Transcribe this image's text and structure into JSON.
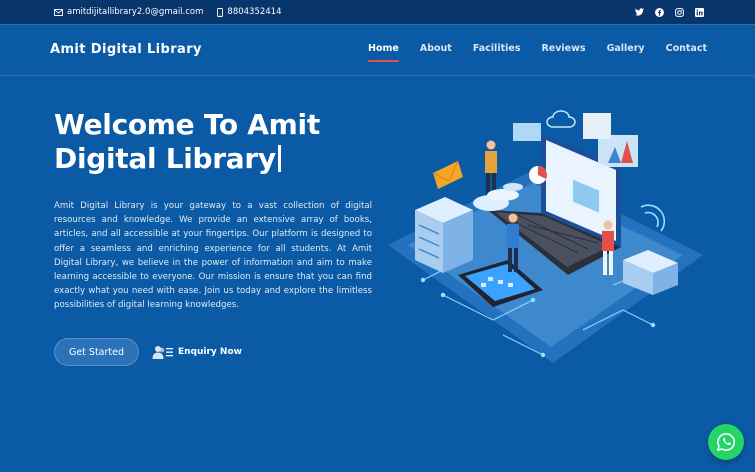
{
  "topbar": {
    "email": "amitdijitallibrary2.0@gmail.com",
    "phone": "8804352414",
    "social": [
      "twitter-icon",
      "facebook-icon",
      "instagram-icon",
      "linkedin-icon"
    ]
  },
  "brand": "Amit Digital Library",
  "nav": {
    "items": [
      "Home",
      "About",
      "Facilities",
      "Reviews",
      "Gallery",
      "Contact"
    ],
    "active": "Home"
  },
  "hero": {
    "title_line1": "Welcome To Amit",
    "title_line2": "Digital Library",
    "description": "Amit Digital Library is your gateway to a vast collection of digital resources and knowledge. We provide an extensive array of books, articles, and all accessible at your fingertips. Our platform is designed to offer a seamless and enriching experience for all students. At Amit Digital Library, we believe in the power of information and aim to make learning accessible to everyone. Our mission is ensure that you can find exactly what you need with ease. Join us today and explore the limitless possibilities of digital learning knowledges.",
    "cta_primary": "Get Started",
    "cta_secondary": "Enquiry Now"
  },
  "colors": {
    "background": "#0b5aa6",
    "topbar": "#08356b",
    "active_underline": "#e2504c",
    "whatsapp": "#25d366"
  },
  "icons": {
    "email": "envelope-icon",
    "phone": "phone-icon",
    "enquiry": "users-list-icon",
    "floating": "whatsapp-icon"
  }
}
